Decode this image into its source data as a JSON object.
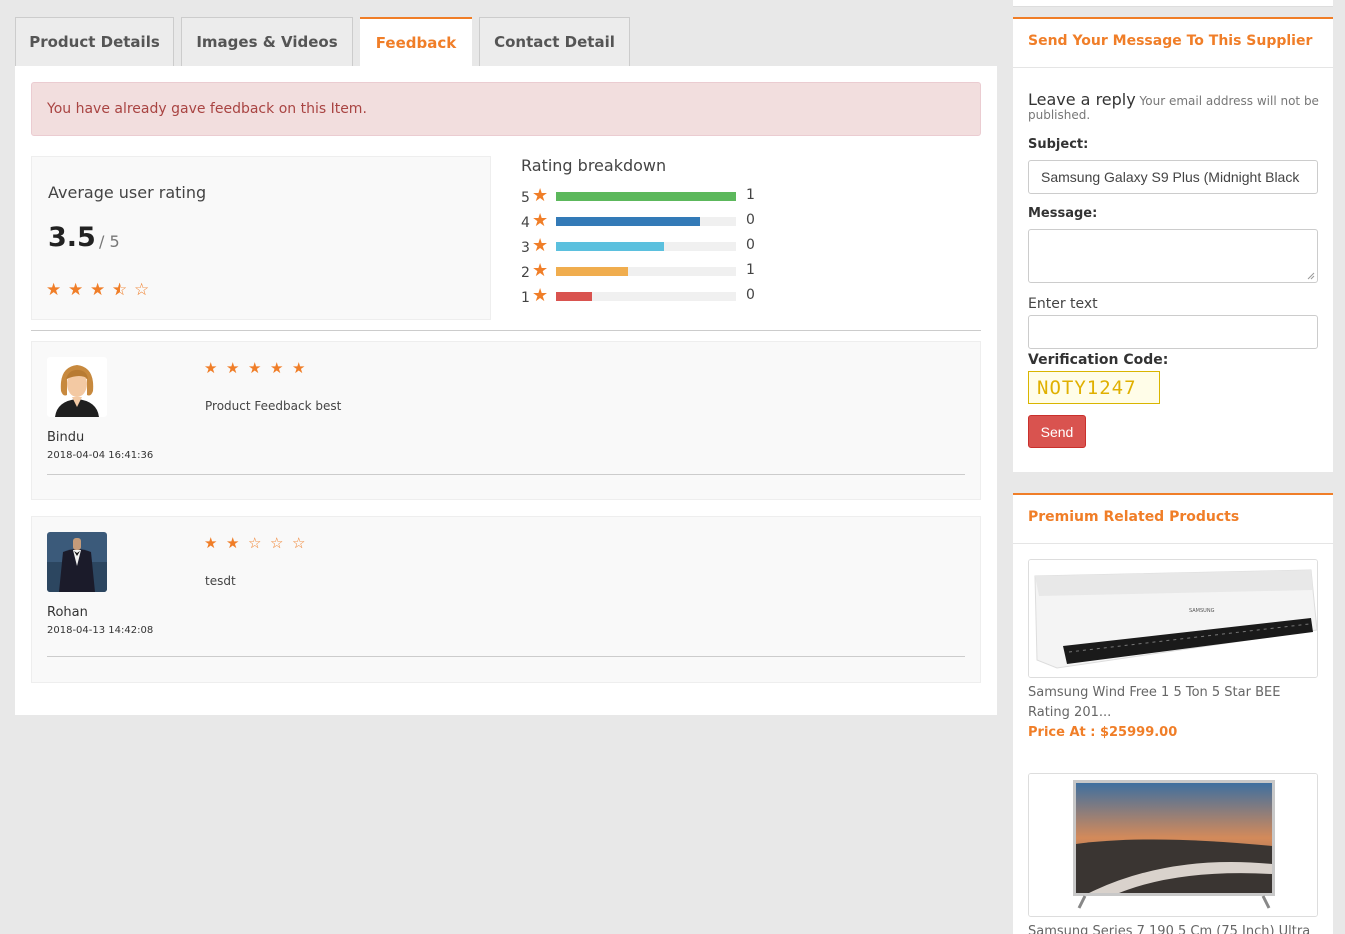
{
  "tabs": [
    {
      "label": "Product Details"
    },
    {
      "label": "Images & Videos"
    },
    {
      "label": "Feedback"
    },
    {
      "label": "Contact Detail"
    }
  ],
  "alert": "You have already gave feedback on this Item.",
  "rating": {
    "title": "Average user rating",
    "value": "3.5",
    "out_of": "/ 5",
    "stars": 3.5
  },
  "breakdown": {
    "title": "Rating breakdown",
    "rows": [
      {
        "stars": "5",
        "count": "1",
        "fill": 1.0,
        "color": "#5cb85c"
      },
      {
        "stars": "4",
        "count": "0",
        "fill": 0.8,
        "color": "#337ab7"
      },
      {
        "stars": "3",
        "count": "0",
        "fill": 0.6,
        "color": "#5bc0de"
      },
      {
        "stars": "2",
        "count": "1",
        "fill": 0.4,
        "color": "#f0ad4e"
      },
      {
        "stars": "1",
        "count": "0",
        "fill": 0.2,
        "color": "#d9534f"
      }
    ]
  },
  "reviews": [
    {
      "name": "Bindu",
      "date": "2018-04-04 16:41:36",
      "rating": 5,
      "text": "Product Feedback best",
      "avatar": "female-avatar"
    },
    {
      "name": "Rohan",
      "date": "2018-04-13 14:42:08",
      "rating": 2,
      "text": "tesdt",
      "avatar": "male-suit-avatar"
    }
  ],
  "contact": {
    "heading": "Send Your Message To This Supplier",
    "reply_title": "Leave a reply",
    "reply_note": "Your email address will not be published.",
    "subject_label": "Subject:",
    "subject_value": "Samsung Galaxy S9 Plus (Midnight Black",
    "message_label": "Message:",
    "enter_text_label": "Enter text",
    "verification_label": "Verification Code:",
    "captcha": "NOTY1247",
    "send_label": "Send"
  },
  "related": {
    "heading": "Premium Related Products",
    "products": [
      {
        "name": "Samsung Wind Free 1 5 Ton 5 Star BEE Rating 201...",
        "price": "Price At : $25999.00"
      },
      {
        "name": "Samsung Series 7 190 5 Cm (75 Inch) Ultra"
      }
    ]
  },
  "colors": {
    "accent": "#f07e28",
    "alert_bg": "#f2dede",
    "alert_text": "#a94442",
    "send_btn": "#d9534f"
  }
}
